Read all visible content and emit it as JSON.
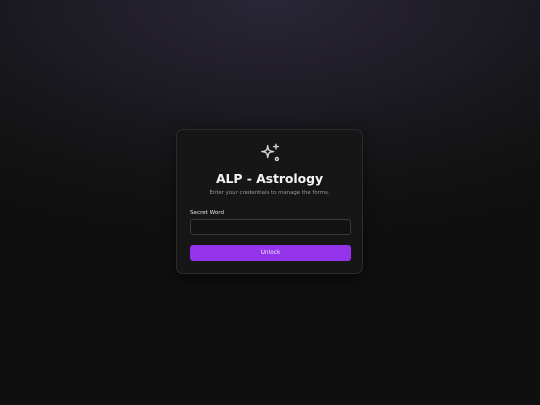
{
  "login": {
    "logo_icon": "sparkles-icon",
    "title": "ALP - Astrology",
    "subtitle": "Enter your credentials to manage the forms.",
    "field_label": "Secret Word",
    "field_value": "",
    "field_placeholder": "",
    "button_label": "Unlock"
  },
  "colors": {
    "accent": "#9333ea",
    "card_background": "#161616",
    "page_background": "#121212"
  }
}
